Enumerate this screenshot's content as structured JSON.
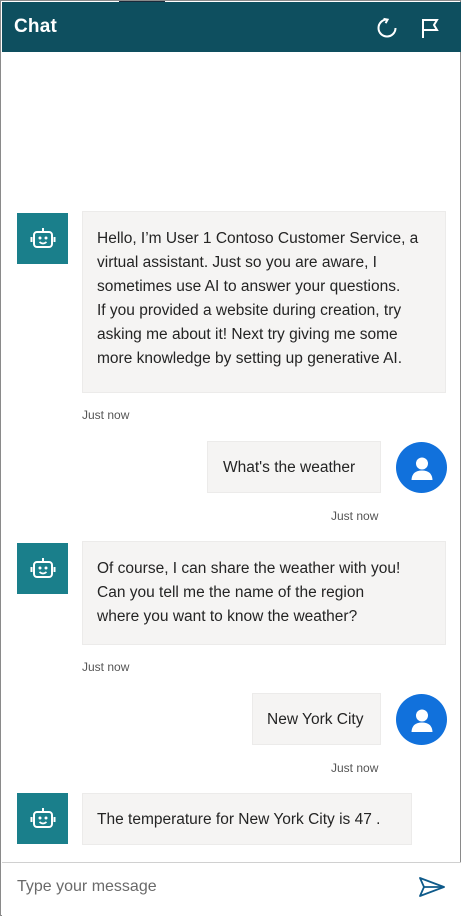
{
  "header": {
    "title": "Chat",
    "restart_icon": "restart-icon",
    "flag_icon": "flag-icon"
  },
  "colors": {
    "header_bg": "#0e4f5f",
    "bot_avatar_bg": "#1a7f8b",
    "user_avatar_bg": "#1171dc",
    "bubble_bg": "#f5f4f3"
  },
  "messages": [
    {
      "sender": "bot",
      "text": "Hello, I’m User 1 Contoso Customer Service, a\nvirtual assistant. Just so you are aware, I\nsometimes use AI to answer your questions.\nIf you provided a website during creation, try\nasking me about it! Next try giving me some\nmore knowledge by setting up generative AI.",
      "timestamp": "Just now"
    },
    {
      "sender": "user",
      "text": "What's the weather",
      "timestamp": "Just now"
    },
    {
      "sender": "bot",
      "text": "Of course, I can share the weather with you!\nCan you tell me the name of the region\nwhere you want to know the weather?",
      "timestamp": "Just now"
    },
    {
      "sender": "user",
      "text": "New York City",
      "timestamp": "Just now"
    },
    {
      "sender": "bot",
      "text": "The temperature for New York City is 47 .",
      "timestamp": ""
    }
  ],
  "composer": {
    "placeholder": "Type your message",
    "value": "",
    "send_icon": "send-icon"
  }
}
